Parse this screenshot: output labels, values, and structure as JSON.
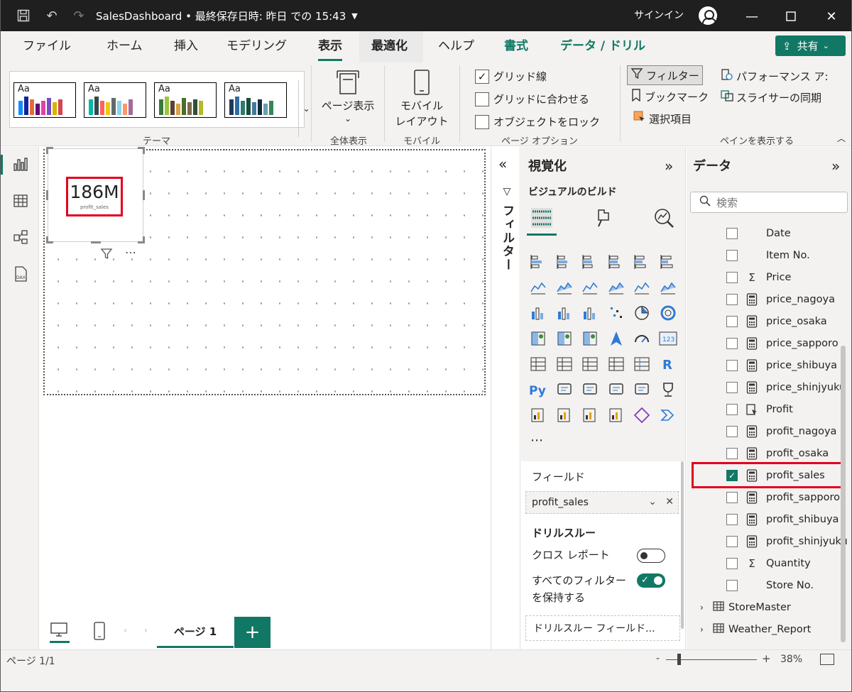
{
  "titlebar": {
    "title": "SalesDashboard • 最終保存日時: 昨日 での 15:43",
    "signin": "サインイン"
  },
  "tabs": [
    {
      "label": "ファイル"
    },
    {
      "label": "ホーム"
    },
    {
      "label": "挿入"
    },
    {
      "label": "モデリング"
    },
    {
      "label": "表示"
    },
    {
      "label": "最適化"
    },
    {
      "label": "ヘルプ"
    },
    {
      "label": "書式"
    },
    {
      "label": "データ / ドリル"
    }
  ],
  "share": {
    "label": "共有"
  },
  "ribbon": {
    "theme_label": "テーマ",
    "themes_aa": "Aa",
    "page_view": {
      "line1": "ページ表示",
      "group": "全体表示"
    },
    "mobile": {
      "line1": "モバイル",
      "line2": "レイアウト",
      "group": "モバイル"
    },
    "page_options": {
      "gridlines": "グリッド線",
      "snap": "グリッドに合わせる",
      "lock": "オブジェクトをロック",
      "group": "ページ オプション"
    },
    "panes": {
      "filter": "フィルター",
      "bookmark": "ブックマーク",
      "selection": "選択項目",
      "performance": "パフォーマンス ア:",
      "slicer_sync": "スライサーの同期",
      "group": "ペインを表示する"
    }
  },
  "card": {
    "value": "186M",
    "label": "profit_sales"
  },
  "pages": {
    "tab": "ページ 1",
    "add": "+"
  },
  "filter_strip": {
    "label": "フィルター"
  },
  "viz_pane": {
    "title": "視覚化",
    "build": "ビジュアルのビルド",
    "fields_label": "フィールド",
    "field_value": "profit_sales",
    "drill_label": "ドリルスルー",
    "cross_report": "クロス レポート",
    "keep_filters_1": "すべてのフィルター",
    "keep_filters_2": "を保持する",
    "drill_fields": "ドリルスルー フィールド..."
  },
  "data_pane": {
    "title": "データ",
    "search_placeholder": "検索",
    "fields": [
      {
        "name": "Date",
        "type": "none",
        "checked": false
      },
      {
        "name": "Item No.",
        "type": "none",
        "checked": false
      },
      {
        "name": "Price",
        "type": "sigma",
        "checked": false
      },
      {
        "name": "price_nagoya",
        "type": "calc",
        "checked": false
      },
      {
        "name": "price_osaka",
        "type": "calc",
        "checked": false
      },
      {
        "name": "price_sapporo",
        "type": "calc",
        "checked": false
      },
      {
        "name": "price_shibuya",
        "type": "calc",
        "checked": false
      },
      {
        "name": "price_shinjyuku",
        "type": "calc",
        "checked": false
      },
      {
        "name": "Profit",
        "type": "param",
        "checked": false
      },
      {
        "name": "profit_nagoya",
        "type": "calc",
        "checked": false
      },
      {
        "name": "profit_osaka",
        "type": "calc",
        "checked": false
      },
      {
        "name": "profit_sales",
        "type": "calc",
        "checked": true
      },
      {
        "name": "profit_sapporo",
        "type": "calc",
        "checked": false
      },
      {
        "name": "profit_shibuya",
        "type": "calc",
        "checked": false
      },
      {
        "name": "profit_shinjyuku",
        "type": "calc",
        "checked": false
      },
      {
        "name": "Quantity",
        "type": "sigma",
        "checked": false
      },
      {
        "name": "Store No.",
        "type": "none",
        "checked": false
      }
    ],
    "tables": [
      {
        "name": "StoreMaster"
      },
      {
        "name": "Weather_Report"
      }
    ]
  },
  "status": {
    "page_count": "ページ 1/1",
    "zoom_minus": "-",
    "zoom_plus": "+",
    "zoom": "38%"
  },
  "colors": {
    "accent": "#117865",
    "highlight": "#e3001b"
  }
}
